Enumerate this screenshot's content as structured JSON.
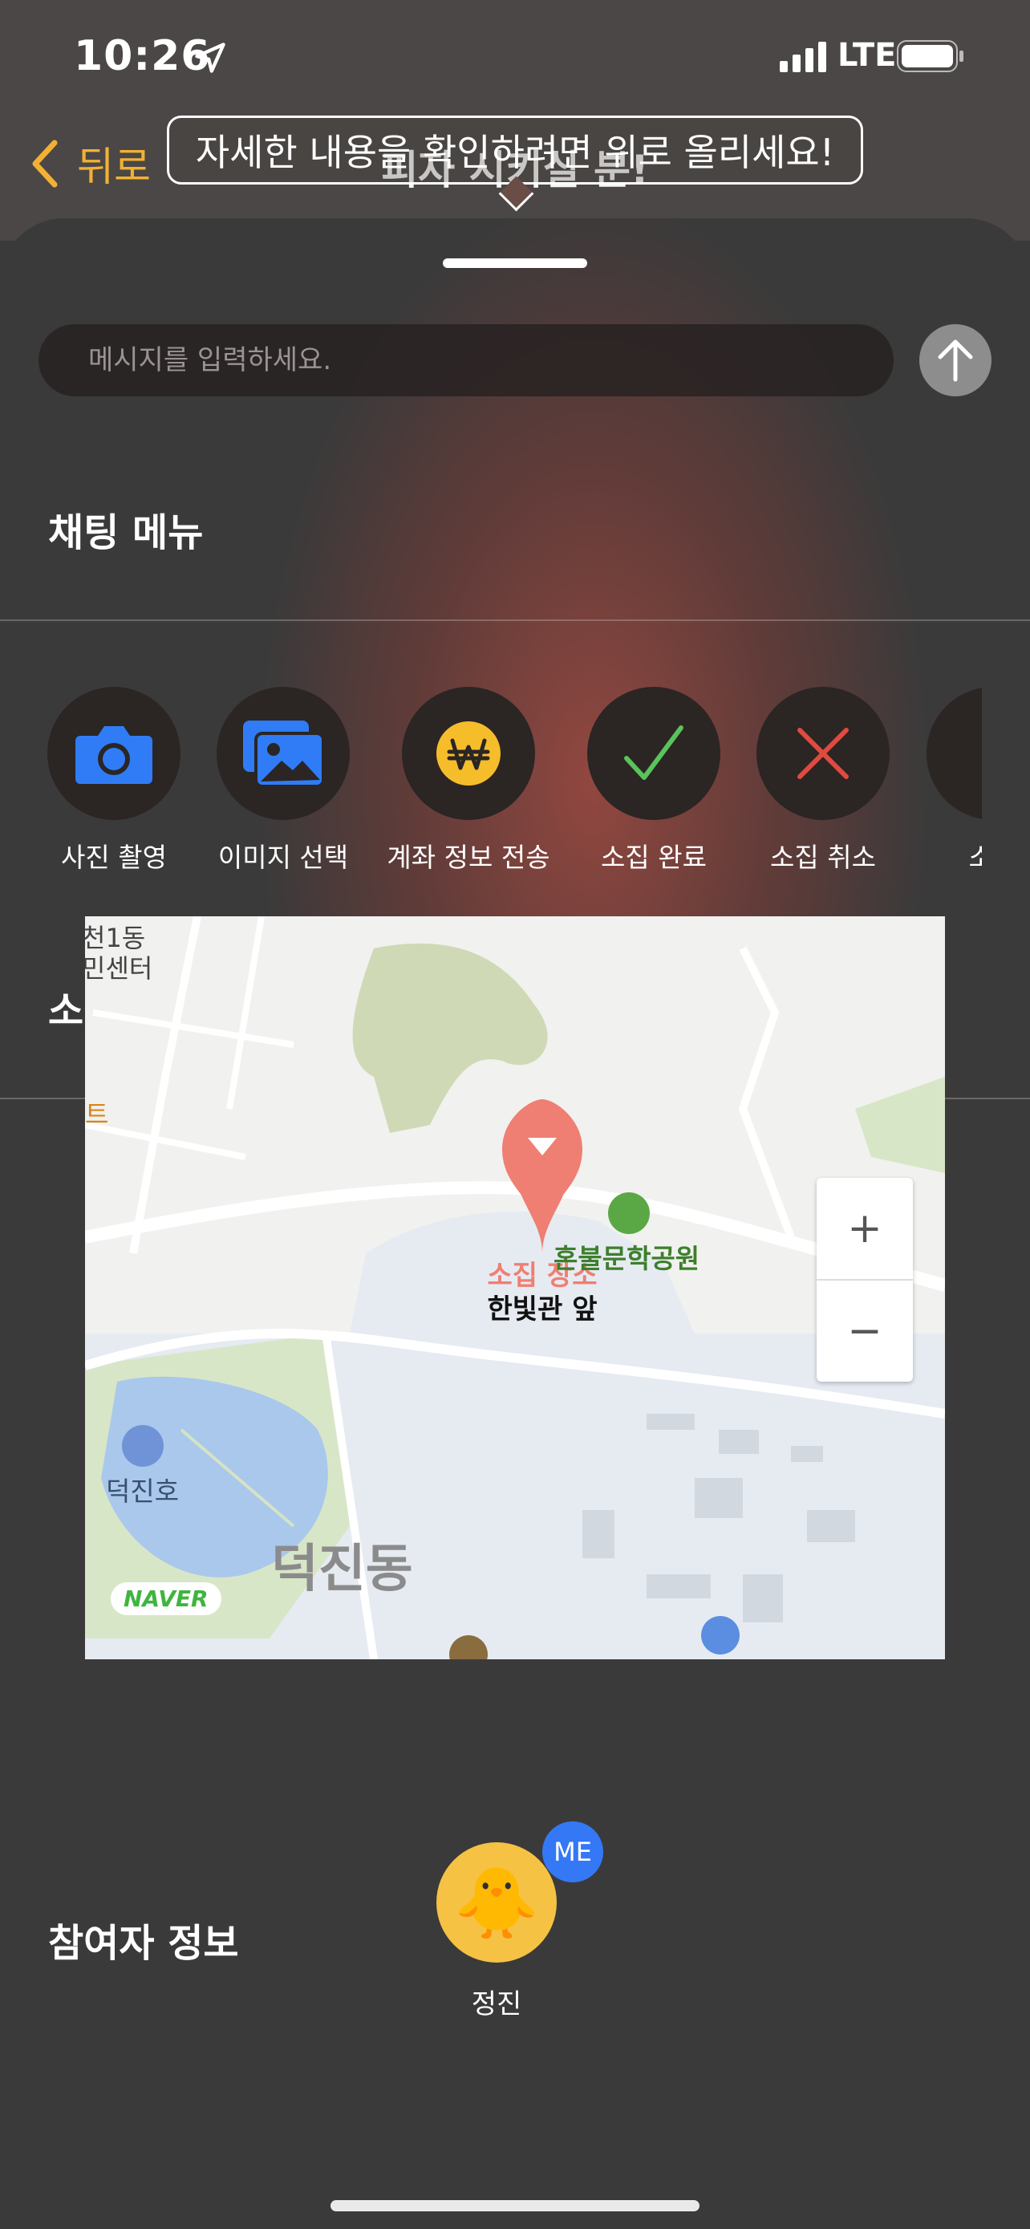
{
  "status_bar": {
    "time": "10:26",
    "network": "LTE"
  },
  "nav": {
    "back_label": "뒤로",
    "title": "피자 시키실 분!"
  },
  "tooltip": {
    "text": "자세한 내용을 확인하려면 위로 올리세요!"
  },
  "message": {
    "placeholder": "메시지를 입력하세요."
  },
  "sections": {
    "chat_menu": "채팅 메뉴",
    "gathering_info": "소집 정보",
    "participants": "참여자 정보"
  },
  "chat_menu_items": [
    {
      "label": "사진 촬영",
      "icon": "camera-icon"
    },
    {
      "label": "이미지 선택",
      "icon": "image-gallery-icon"
    },
    {
      "label": "계좌 정보 전송",
      "icon": "won-coin-icon"
    },
    {
      "label": "소집 완료",
      "icon": "checkmark-icon"
    },
    {
      "label": "소집 취소",
      "icon": "x-cancel-icon"
    },
    {
      "label": "소집",
      "icon": "report-icon"
    }
  ],
  "map": {
    "pin_label": "소집 장소",
    "pin_place": "한빛관 앞",
    "labels": {
      "park": "혼불문학공원",
      "lake": "덕진호",
      "district": "덕진동",
      "corner_top": "천1동",
      "corner_mid": "민센터",
      "corner_left": "트",
      "brand": "NAVER"
    },
    "zoom_in": "+",
    "zoom_out": "−"
  },
  "participants": [
    {
      "name": "정진",
      "badge": "ME",
      "avatar": "🐥"
    }
  ],
  "colors": {
    "accent": "#f2b134",
    "badge": "#3478f6",
    "pin": "#ef7f72"
  }
}
